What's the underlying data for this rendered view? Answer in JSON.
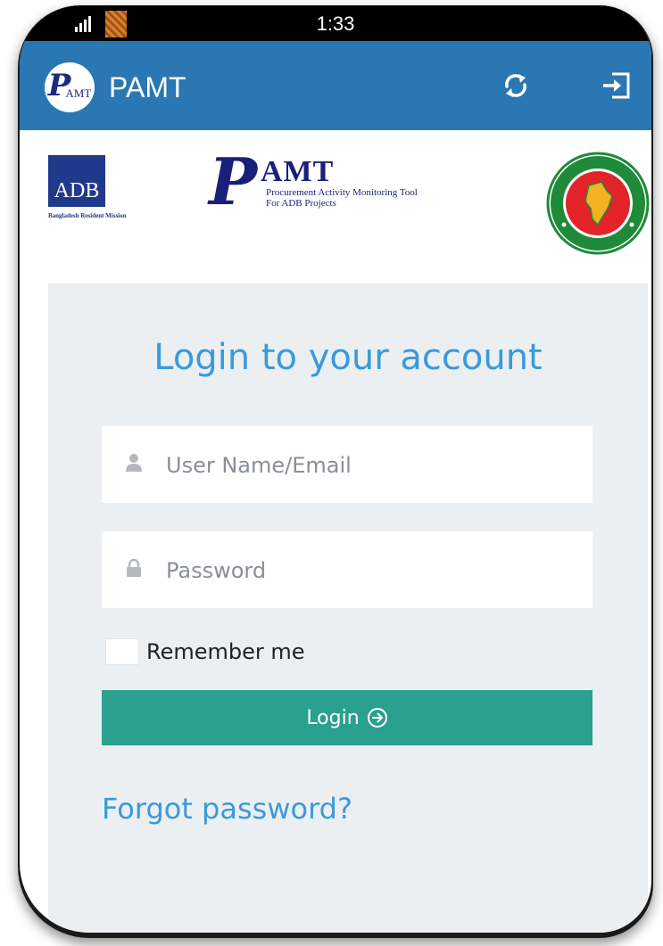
{
  "status_bar": {
    "time": "1:33"
  },
  "app_bar": {
    "logo_letter": "P",
    "logo_text": "AMT",
    "title": "PAMT",
    "icons": [
      "refresh-icon",
      "logout-icon"
    ]
  },
  "logos": {
    "adb": {
      "label": "ADB",
      "caption": "Bangladesh Resident Mission"
    },
    "pamt": {
      "letter": "P",
      "word": "AMT",
      "line1": "Procurement Activity Monitoring Tool",
      "line2": "For ADB Projects"
    },
    "seal": {
      "colors": {
        "ring": "#1f8a3a",
        "disc": "#e2232a",
        "map": "#f4b21e"
      }
    }
  },
  "login": {
    "heading": "Login to your account",
    "username": {
      "placeholder": "User Name/Email",
      "value": "",
      "icon": "user-icon"
    },
    "password": {
      "placeholder": "Password",
      "value": "",
      "icon": "lock-icon"
    },
    "remember_label": "Remember me",
    "remember_checked": false,
    "button_label": "Login",
    "button_icon": "arrow-circle-right-icon",
    "forgot_label": "Forgot password?"
  },
  "colors": {
    "appbar": "#2a77b3",
    "accent_text": "#3a9ad9",
    "button": "#2aa08f",
    "panel": "#eceff2"
  }
}
